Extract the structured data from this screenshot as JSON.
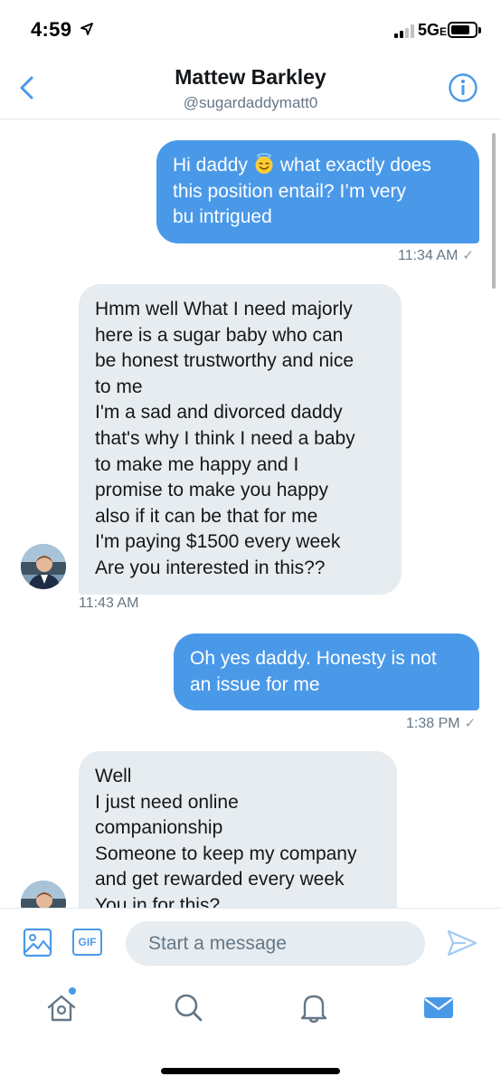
{
  "status_bar": {
    "time": "4:59",
    "network": "5G",
    "network_suffix": "E"
  },
  "header": {
    "name": "Mattew Barkley",
    "handle": "@sugardaddymatt0"
  },
  "messages": [
    {
      "direction": "sent",
      "lines": [
        "Hi daddy",
        "what exactly does",
        "this position entail? I’m very",
        "bu intrigued"
      ],
      "emoji": "smiling-face-with-halo",
      "time": "11:34 AM",
      "check": "✓"
    },
    {
      "direction": "received",
      "lines": [
        "Hmm well What I need majorly",
        "here is a sugar baby who can",
        "be honest trustworthy and nice",
        "to me",
        "I'm a sad and divorced daddy",
        "that's why I think I need a baby",
        "to make me happy and I",
        "promise to make you happy",
        "also if it can be that for me",
        "I'm paying $1500 every week",
        "Are you interested in this??"
      ],
      "time": "11:43 AM"
    },
    {
      "direction": "sent",
      "lines": [
        "Oh yes daddy. Honesty is not",
        "an issue for me"
      ],
      "time": "1:38 PM",
      "check": "✓"
    },
    {
      "direction": "received",
      "lines": [
        "Well",
        "I just need online",
        "companionship",
        "Someone to keep my company",
        "and get rewarded every week",
        "You in for this?"
      ]
    }
  ],
  "composer": {
    "gif_label": "GIF",
    "placeholder": "Start a message"
  },
  "colors": {
    "accent": "#4a99e9",
    "received_bubble": "#e6ecf0",
    "secondary_text": "#657786"
  },
  "tabs": [
    "home-icon",
    "search-icon",
    "notifications-bell-icon",
    "messages-envelope-icon"
  ],
  "active_tab": "messages-envelope-icon"
}
